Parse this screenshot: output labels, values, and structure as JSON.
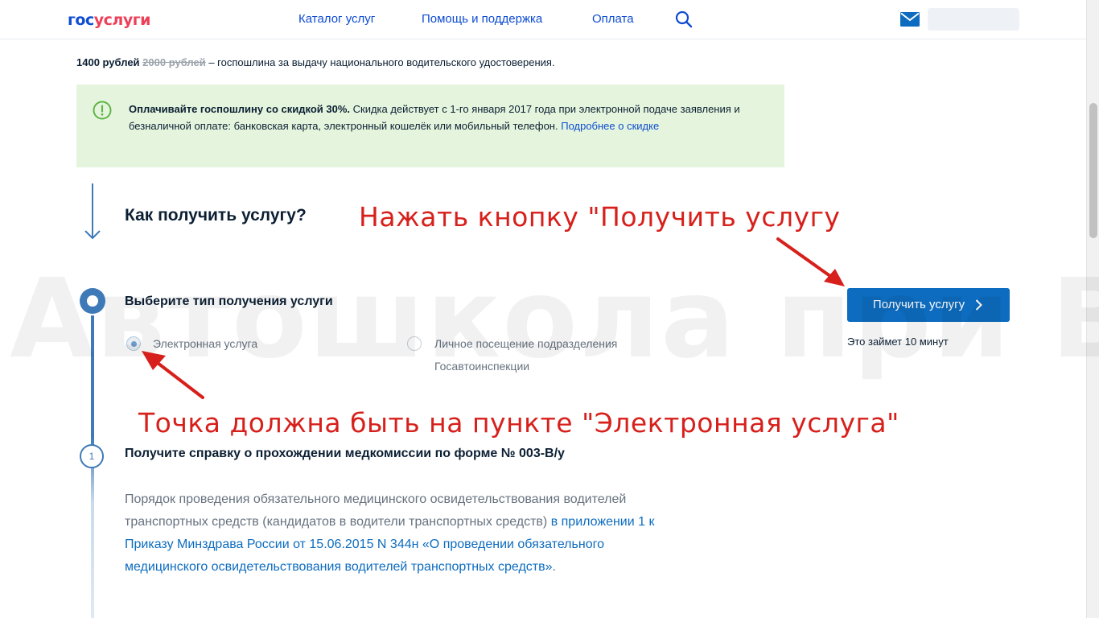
{
  "header": {
    "logo_part1": "гос",
    "logo_part2": "услуги",
    "nav": [
      "Каталог услуг",
      "Помощь и поддержка",
      "Оплата"
    ]
  },
  "fee": {
    "price": "1400 рублей",
    "old_price": "2000 рублей",
    "description": " – госпошлина за выдачу национального водительского удостоверения."
  },
  "discount_box": {
    "bold": "Оплачивайте госпошлину со скидкой 30%.",
    "text": " Скидка действует с 1-го января 2017 года при электронной подаче заявления и безналичной оплате: банковская карта, электронный кошелёк или мобильный телефон. ",
    "link": "Подробнее о скидке"
  },
  "how_title": "Как получить услугу?",
  "choose": {
    "title": "Выберите тип получения услуги",
    "options": [
      {
        "label": "Электронная услуга",
        "selected": true
      },
      {
        "label_line1": "Личное посещение подразделения",
        "label_line2": "Госавтоинспекции",
        "selected": false
      }
    ]
  },
  "action": {
    "button_label": "Получить услугу",
    "time_note": "Это займет 10 минут"
  },
  "step1": {
    "number": "1",
    "title": "Получите справку о прохождении медкомиссии по форме № 003-В/у",
    "text": "Порядок проведения обязательного медицинского освидетельствования водителей транспортных средств (кандидатов в водители транспортных средств) ",
    "link": "в приложении 1 к Приказу Минздрава России от 15.06.2015 N 344н «О проведении обязательного медицинского освидетельствования водителей транспортных средств»",
    "tail": "."
  },
  "watermark": "Автошкола при ВГУ",
  "annotations": {
    "top": "Нажать кнопку \"Получить услугу",
    "bottom": "Точка должна быть на пункте \"Электронная услуга\""
  },
  "colors": {
    "brand_blue": "#0d4cd3",
    "brand_red": "#ee3f58",
    "button": "#0d6cbf",
    "info_bg": "#e5f5dd",
    "annotation": "#d7201b"
  }
}
